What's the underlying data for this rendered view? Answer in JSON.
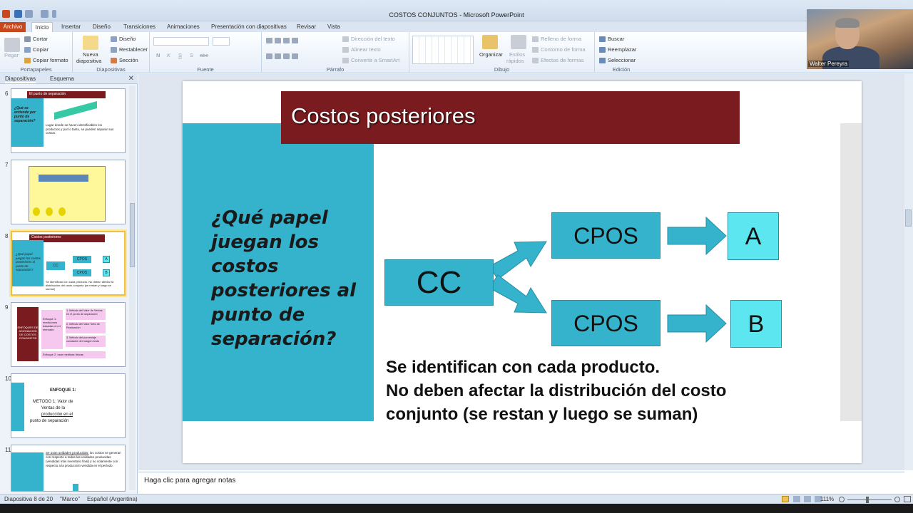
{
  "window": {
    "title": "COSTOS CONJUNTOS - Microsoft PowerPoint"
  },
  "tabs": [
    "Archivo",
    "Inicio",
    "Insertar",
    "Diseño",
    "Transiciones",
    "Animaciones",
    "Presentación con diapositivas",
    "Revisar",
    "Vista"
  ],
  "ribbon": {
    "portapapeles": {
      "label": "Portapapeles",
      "pegar": "Pegar",
      "cortar": "Cortar",
      "copiar": "Copiar",
      "copiar_formato": "Copiar formato"
    },
    "diapositivas": {
      "label": "Diapositivas",
      "nueva": "Nueva",
      "nueva2": "diapositiva",
      "diseno": "Diseño",
      "restablecer": "Restablecer",
      "seccion": "Sección"
    },
    "fuente": {
      "label": "Fuente",
      "bold": "N",
      "italic": "K",
      "underline": "S",
      "shadow": "S",
      "strike": "abc"
    },
    "parrafo": {
      "label": "Párrafo",
      "direccion": "Dirección del texto",
      "alinear": "Alinear texto",
      "convertir": "Convertir a SmartArt"
    },
    "dibujo": {
      "label": "Dibujo",
      "organizar": "Organizar",
      "estilos": "Estilos",
      "estilos2": "rápidos",
      "relleno": "Relleno de forma",
      "contorno": "Contorno de forma",
      "efectos": "Efectos de formas"
    },
    "edicion": {
      "label": "Edición",
      "buscar": "Buscar",
      "reemplazar": "Reemplazar",
      "seleccionar": "Seleccionar"
    }
  },
  "webcam": {
    "name": "Walter Pereyra"
  },
  "panel": {
    "tab_diapositivas": "Diapositivas",
    "tab_esquema": "Esquema"
  },
  "thumbs": [
    {
      "num": "6",
      "title": "El punto de separación",
      "q": "¿Qué se entiende por punto de separación?",
      "text": "Lugar donde se hacen identificables los productos y por lo tanto, se pueden separar sus costos."
    },
    {
      "num": "7"
    },
    {
      "num": "8",
      "title": "Costos posteriores",
      "q": "¿Qué papel juegan los costos posteriores al punto de separación?",
      "cc": "CC",
      "cpos": "CPOS",
      "a": "A",
      "b": "B",
      "text": "Se identifican con cada producto. No deben afectar la distribución del costo conjunto (se restan y luego se suman)"
    },
    {
      "num": "9",
      "left": "ENFOQUES DE ASIGNACION DE COSTOS CONJUNTOS",
      "mid": "Enfoque 1: mediciones basadas en el mercado",
      "m1": "1. Método del Valor de Ventas en el punto de separación",
      "m2": "2. Método del Valor Neto de Realización",
      "m3": "3. Método del porcentaje constante del margen bruto",
      "bottom": "Enfoque 2: usar medidas físicas"
    },
    {
      "num": "10",
      "h": "ENFOQUE 1:",
      "t1": "METODO 1: Valor de",
      "t2": "Ventas de la",
      "t3": "producción en el",
      "t4": "punto de separación"
    },
    {
      "num": "11",
      "t1": "Se usan unidades producidas:",
      "t2": "los costos se generan con respecto a todas las unidades producidas (vendidas más inventario final) y no solamente con respecto a la producción vendida en el período."
    }
  ],
  "slide": {
    "title": "Costos posteriores",
    "question": "¿Qué papel juegan los costos posteriores al punto de separación?",
    "cc": "CC",
    "cpos_top": "CPOS",
    "cpos_bottom": "CPOS",
    "a": "A",
    "b": "B",
    "note1": "Se identifican con cada producto.",
    "note2": "No deben afectar la distribución del costo conjunto (se restan y luego se suman)"
  },
  "notes": {
    "placeholder": "Haga clic para agregar notas"
  },
  "status": {
    "slide": "Diapositiva 8 de 20",
    "theme": "\"Marco\"",
    "lang": "Español (Argentina)",
    "zoom": "111%"
  },
  "colors": {
    "accent": "#35b3cc",
    "title_bar": "#7a1b1f",
    "light_box": "#5ce6ef"
  }
}
